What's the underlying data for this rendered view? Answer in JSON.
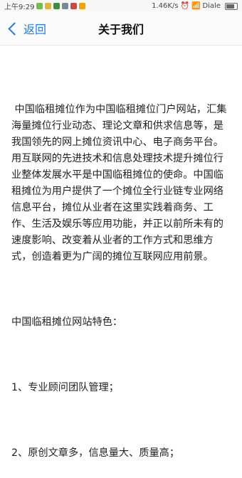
{
  "status_bar": {
    "time": "上午9:29",
    "speed": "1.46K/s",
    "carrier": "Diale"
  },
  "nav": {
    "back_label": "返回",
    "title": "关于我们"
  },
  "content": {
    "intro": " 中国临租摊位作为中国临租摊位门户网站，汇集海量摊位行业动态、理论文章和供求信息等，是我国领先的网上摊位资讯中心、电子商务平台。\n用互联网的先进技术和信息处理技术提升摊位行业整体发展水平是中国临租摊位的使命。中国临租摊位为用户提供了一个摊位全行业链专业网络信息平台，摊位从业者在这里实践着商务、工作、生活及娱乐等应用功能，并正以前所未有的速度影响、改变着从业者的工作方式和思维方式，创造着更为广阔的摊位互联网应用前景。",
    "features_heading": "中国临租摊位网站特色：",
    "feature_1": "1、专业顾问团队管理；",
    "feature_2": "2、原创文章多，信息量大、质量高；"
  }
}
